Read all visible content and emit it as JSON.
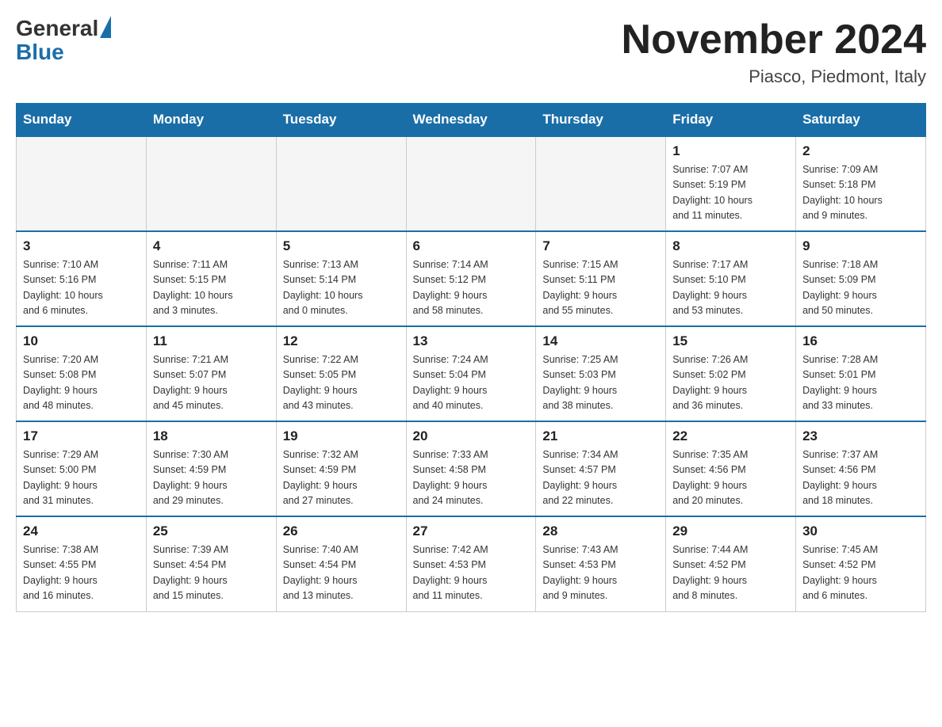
{
  "header": {
    "logo_general": "General",
    "logo_blue": "Blue",
    "title": "November 2024",
    "location": "Piasco, Piedmont, Italy"
  },
  "weekdays": [
    "Sunday",
    "Monday",
    "Tuesday",
    "Wednesday",
    "Thursday",
    "Friday",
    "Saturday"
  ],
  "weeks": [
    [
      {
        "day": "",
        "info": ""
      },
      {
        "day": "",
        "info": ""
      },
      {
        "day": "",
        "info": ""
      },
      {
        "day": "",
        "info": ""
      },
      {
        "day": "",
        "info": ""
      },
      {
        "day": "1",
        "info": "Sunrise: 7:07 AM\nSunset: 5:19 PM\nDaylight: 10 hours\nand 11 minutes."
      },
      {
        "day": "2",
        "info": "Sunrise: 7:09 AM\nSunset: 5:18 PM\nDaylight: 10 hours\nand 9 minutes."
      }
    ],
    [
      {
        "day": "3",
        "info": "Sunrise: 7:10 AM\nSunset: 5:16 PM\nDaylight: 10 hours\nand 6 minutes."
      },
      {
        "day": "4",
        "info": "Sunrise: 7:11 AM\nSunset: 5:15 PM\nDaylight: 10 hours\nand 3 minutes."
      },
      {
        "day": "5",
        "info": "Sunrise: 7:13 AM\nSunset: 5:14 PM\nDaylight: 10 hours\nand 0 minutes."
      },
      {
        "day": "6",
        "info": "Sunrise: 7:14 AM\nSunset: 5:12 PM\nDaylight: 9 hours\nand 58 minutes."
      },
      {
        "day": "7",
        "info": "Sunrise: 7:15 AM\nSunset: 5:11 PM\nDaylight: 9 hours\nand 55 minutes."
      },
      {
        "day": "8",
        "info": "Sunrise: 7:17 AM\nSunset: 5:10 PM\nDaylight: 9 hours\nand 53 minutes."
      },
      {
        "day": "9",
        "info": "Sunrise: 7:18 AM\nSunset: 5:09 PM\nDaylight: 9 hours\nand 50 minutes."
      }
    ],
    [
      {
        "day": "10",
        "info": "Sunrise: 7:20 AM\nSunset: 5:08 PM\nDaylight: 9 hours\nand 48 minutes."
      },
      {
        "day": "11",
        "info": "Sunrise: 7:21 AM\nSunset: 5:07 PM\nDaylight: 9 hours\nand 45 minutes."
      },
      {
        "day": "12",
        "info": "Sunrise: 7:22 AM\nSunset: 5:05 PM\nDaylight: 9 hours\nand 43 minutes."
      },
      {
        "day": "13",
        "info": "Sunrise: 7:24 AM\nSunset: 5:04 PM\nDaylight: 9 hours\nand 40 minutes."
      },
      {
        "day": "14",
        "info": "Sunrise: 7:25 AM\nSunset: 5:03 PM\nDaylight: 9 hours\nand 38 minutes."
      },
      {
        "day": "15",
        "info": "Sunrise: 7:26 AM\nSunset: 5:02 PM\nDaylight: 9 hours\nand 36 minutes."
      },
      {
        "day": "16",
        "info": "Sunrise: 7:28 AM\nSunset: 5:01 PM\nDaylight: 9 hours\nand 33 minutes."
      }
    ],
    [
      {
        "day": "17",
        "info": "Sunrise: 7:29 AM\nSunset: 5:00 PM\nDaylight: 9 hours\nand 31 minutes."
      },
      {
        "day": "18",
        "info": "Sunrise: 7:30 AM\nSunset: 4:59 PM\nDaylight: 9 hours\nand 29 minutes."
      },
      {
        "day": "19",
        "info": "Sunrise: 7:32 AM\nSunset: 4:59 PM\nDaylight: 9 hours\nand 27 minutes."
      },
      {
        "day": "20",
        "info": "Sunrise: 7:33 AM\nSunset: 4:58 PM\nDaylight: 9 hours\nand 24 minutes."
      },
      {
        "day": "21",
        "info": "Sunrise: 7:34 AM\nSunset: 4:57 PM\nDaylight: 9 hours\nand 22 minutes."
      },
      {
        "day": "22",
        "info": "Sunrise: 7:35 AM\nSunset: 4:56 PM\nDaylight: 9 hours\nand 20 minutes."
      },
      {
        "day": "23",
        "info": "Sunrise: 7:37 AM\nSunset: 4:56 PM\nDaylight: 9 hours\nand 18 minutes."
      }
    ],
    [
      {
        "day": "24",
        "info": "Sunrise: 7:38 AM\nSunset: 4:55 PM\nDaylight: 9 hours\nand 16 minutes."
      },
      {
        "day": "25",
        "info": "Sunrise: 7:39 AM\nSunset: 4:54 PM\nDaylight: 9 hours\nand 15 minutes."
      },
      {
        "day": "26",
        "info": "Sunrise: 7:40 AM\nSunset: 4:54 PM\nDaylight: 9 hours\nand 13 minutes."
      },
      {
        "day": "27",
        "info": "Sunrise: 7:42 AM\nSunset: 4:53 PM\nDaylight: 9 hours\nand 11 minutes."
      },
      {
        "day": "28",
        "info": "Sunrise: 7:43 AM\nSunset: 4:53 PM\nDaylight: 9 hours\nand 9 minutes."
      },
      {
        "day": "29",
        "info": "Sunrise: 7:44 AM\nSunset: 4:52 PM\nDaylight: 9 hours\nand 8 minutes."
      },
      {
        "day": "30",
        "info": "Sunrise: 7:45 AM\nSunset: 4:52 PM\nDaylight: 9 hours\nand 6 minutes."
      }
    ]
  ]
}
